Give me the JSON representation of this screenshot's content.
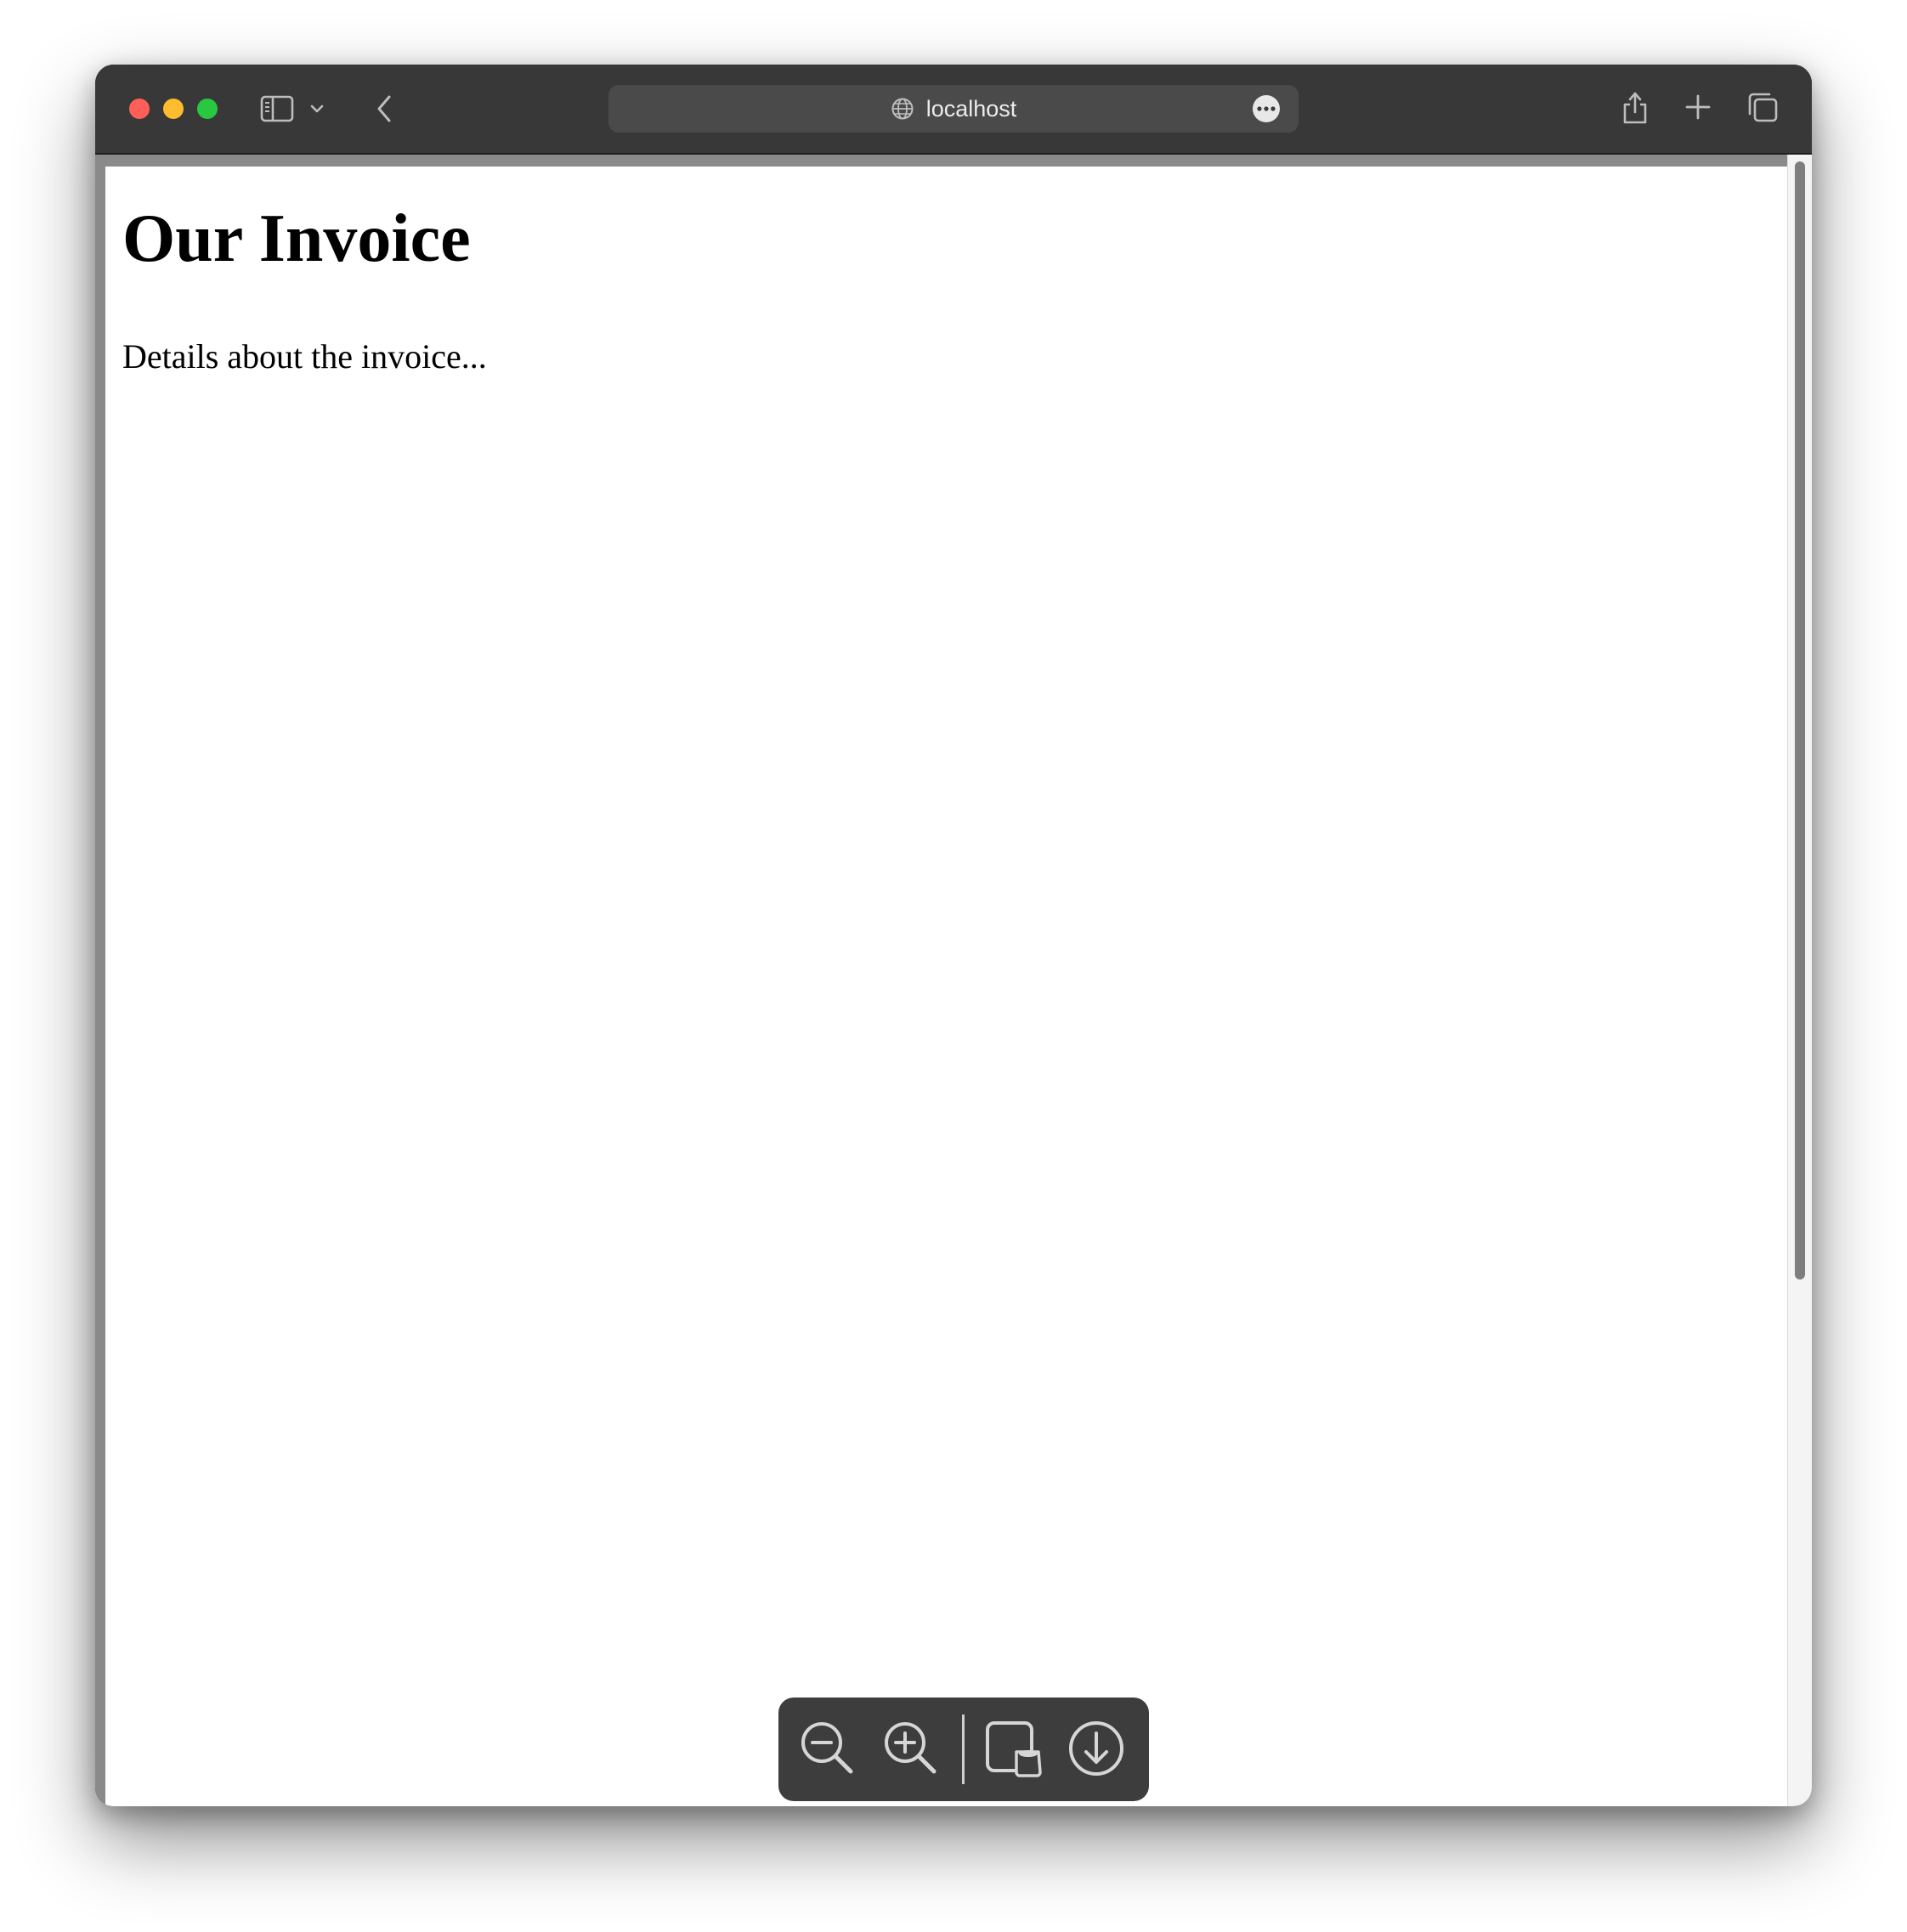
{
  "browser": {
    "address": "localhost",
    "icons": {
      "sidebar": "sidebar-toggle-icon",
      "sidebar_menu": "chevron-down-icon",
      "back": "chevron-left-icon",
      "site": "globe-icon",
      "more": "ellipsis-icon",
      "share": "share-icon",
      "new_tab": "plus-icon",
      "tabs": "tab-overview-icon"
    },
    "colors": {
      "close": "#ff5f57",
      "minimize": "#febc2e",
      "zoom": "#28c840"
    }
  },
  "page": {
    "title": "Our Invoice",
    "details": "Details about the invoice..."
  },
  "pdf_toolbar": {
    "icons": [
      "zoom-out-icon",
      "zoom-in-icon",
      "open-in-preview-icon",
      "download-icon"
    ]
  }
}
